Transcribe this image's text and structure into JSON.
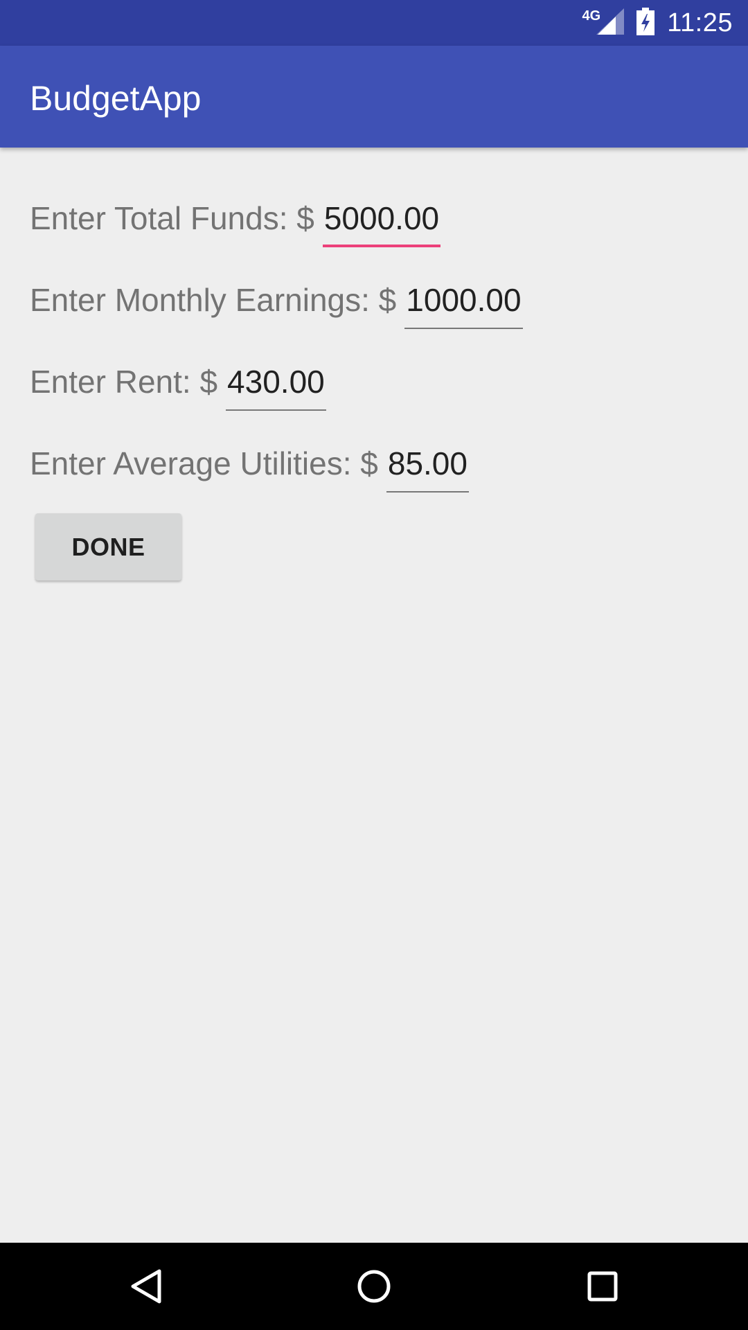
{
  "status_bar": {
    "network_label": "4G",
    "time": "11:25"
  },
  "app_bar": {
    "title": "BudgetApp"
  },
  "form": {
    "fields": [
      {
        "label": "Enter Total Funds: $",
        "value": "5000.00",
        "focused": true
      },
      {
        "label": "Enter Monthly Earnings: $",
        "value": "1000.00",
        "focused": false
      },
      {
        "label": "Enter Rent: $",
        "value": "430.00",
        "focused": false
      },
      {
        "label": "Enter Average Utilities: $",
        "value": "85.00",
        "focused": false
      }
    ],
    "done_label": "DONE"
  },
  "nav_bar": {
    "icons": [
      "back-icon",
      "home-icon",
      "recents-icon"
    ]
  },
  "colors": {
    "status_bar": "#303f9f",
    "app_bar": "#3f51b5",
    "accent": "#ec407a",
    "background": "#eeeeee"
  }
}
